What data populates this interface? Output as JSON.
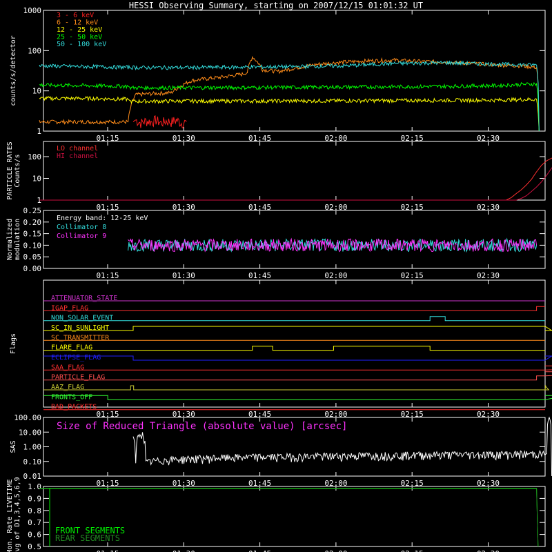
{
  "title": "HESSI Observing Summary, starting on 2007/12/15 01:01:32 UT",
  "time_ticks": [
    "01:15",
    "01:30",
    "01:45",
    "02:00",
    "02:15",
    "02:30"
  ],
  "colors": {
    "e3_6": "#ff2020",
    "e6_12": "#ff8c1a",
    "e12_25": "#ffff00",
    "e25_50": "#00ff00",
    "e50_100": "#33dddd",
    "lo": "#ff3030",
    "hi": "#cc1040",
    "coll8": "#33dddd",
    "coll9": "#ff33ff",
    "white": "#ffffff"
  },
  "chart_data": [
    {
      "type": "line",
      "panel": "count_rates",
      "ylabel": "counts/s/detector",
      "yscale": "log",
      "ylim": [
        1,
        1000
      ],
      "yticks": [
        "1",
        "10",
        "100",
        "1000"
      ],
      "x_unit": "minutes since 01:01:32",
      "xlim": [
        0,
        108
      ],
      "series": [
        {
          "name": "3 - 6 keV",
          "color": "#ff2020",
          "x": [
            18.5,
            19,
            20,
            21,
            22,
            23,
            24,
            25,
            26,
            27,
            28,
            29
          ],
          "y": [
            1.7,
            1.9,
            1.6,
            1.8,
            1.7,
            1.9,
            1.6,
            1.8,
            1.7,
            1.9,
            1.6,
            1.7
          ]
        },
        {
          "name": "6 - 12 keV",
          "color": "#ff8c1a",
          "x": [
            0,
            5,
            10,
            14,
            17.5,
            19,
            22,
            26,
            30,
            33,
            36,
            38,
            40,
            41,
            42,
            44,
            47,
            50,
            55,
            60,
            65,
            70,
            75,
            80,
            85,
            90,
            95,
            98,
            98.5
          ],
          "y": [
            1.7,
            1.7,
            1.7,
            1.7,
            1.7,
            8,
            8.5,
            9,
            18,
            20,
            22,
            24,
            26,
            29,
            70,
            34,
            30,
            36,
            46,
            52,
            56,
            58,
            54,
            52,
            48,
            44,
            42,
            38,
            1
          ]
        },
        {
          "name": "12 - 25 keV",
          "color": "#ffff00",
          "x": [
            0,
            10,
            17.5,
            18,
            30,
            45,
            60,
            75,
            90,
            98,
            98.5
          ],
          "y": [
            6.5,
            6.5,
            6.2,
            5.5,
            5.6,
            5.6,
            5.7,
            5.8,
            5.9,
            6.2,
            1
          ]
        },
        {
          "name": "25 - 50 keV",
          "color": "#00ff00",
          "x": [
            0,
            10,
            17.5,
            18,
            30,
            45,
            60,
            75,
            90,
            98,
            98.5
          ],
          "y": [
            14,
            13.5,
            13,
            12,
            12,
            12.2,
            12.5,
            12.8,
            13.5,
            15,
            1
          ]
        },
        {
          "name": "50 - 100 keV",
          "color": "#33dddd",
          "x": [
            0,
            10,
            20,
            30,
            40,
            50,
            60,
            70,
            80,
            90,
            98,
            98.5
          ],
          "y": [
            42,
            40,
            38,
            38,
            39,
            40,
            42,
            48,
            50,
            46,
            44,
            1
          ]
        }
      ]
    },
    {
      "type": "line",
      "panel": "particle_rates",
      "ylabel": "PARTICLE RATES Counts/s",
      "yscale": "log",
      "ylim": [
        1,
        500
      ],
      "yticks": [
        "1",
        "10",
        "100"
      ],
      "x_unit": "minutes since 01:01:32",
      "xlim": [
        0,
        108
      ],
      "series": [
        {
          "name": "LO channel",
          "color": "#ff3030",
          "x": [
            0,
            92,
            93,
            94,
            95,
            96,
            97,
            98,
            99,
            100,
            101,
            102,
            104,
            106,
            110,
            116,
            118,
            119,
            120,
            121,
            122,
            123,
            124,
            125,
            126,
            130
          ],
          "y": [
            1,
            1,
            1.3,
            2,
            3,
            5,
            9,
            20,
            40,
            65,
            85,
            100,
            115,
            120,
            120,
            118,
            110,
            90,
            60,
            30,
            10,
            3,
            1.5,
            1,
            1,
            1
          ]
        },
        {
          "name": "HI channel",
          "color": "#cc1040",
          "x": [
            0,
            94,
            95,
            96,
            97,
            98,
            99,
            100,
            101,
            102,
            103,
            104,
            106,
            108,
            112,
            118,
            120,
            121,
            122,
            123,
            124,
            125,
            126,
            127,
            130
          ],
          "y": [
            1,
            1,
            1.2,
            1.6,
            2.5,
            4,
            7,
            14,
            30,
            55,
            80,
            95,
            105,
            110,
            110,
            105,
            95,
            70,
            40,
            18,
            6,
            2,
            1.2,
            1,
            1
          ]
        }
      ]
    },
    {
      "type": "line",
      "panel": "modulation",
      "ylabel": "Normalized modulation",
      "ylim": [
        0,
        0.25
      ],
      "yticks": [
        "0.00",
        "0.05",
        "0.10",
        "0.15",
        "0.20",
        "0.25"
      ],
      "annotation": "Energy band: 12-25 keV",
      "x_unit": "minutes since 01:01:32",
      "xlim": [
        0,
        108
      ],
      "series": [
        {
          "name": "Collimator 8",
          "color": "#33dddd",
          "x": [
            17.5,
            30,
            45,
            60,
            75,
            90,
            98
          ],
          "y": [
            0.1,
            0.1,
            0.1,
            0.1,
            0.1,
            0.1,
            0.1
          ]
        },
        {
          "name": "Collimator 9",
          "color": "#ff33ff",
          "x": [
            17.5,
            30,
            45,
            60,
            75,
            90,
            98
          ],
          "y": [
            0.1,
            0.1,
            0.1,
            0.1,
            0.1,
            0.1,
            0.1
          ]
        }
      ]
    },
    {
      "type": "line",
      "panel": "flags",
      "ylabel": "Flags",
      "flags": [
        {
          "name": "ATTENUATOR_STATE",
          "color": "#cc33cc",
          "segments": [
            [
              0,
              130,
              0
            ]
          ]
        },
        {
          "name": "IGAP_FLAG",
          "color": "#ff3030",
          "segments": [
            [
              0,
              98,
              0
            ],
            [
              98,
              130,
              1
            ]
          ]
        },
        {
          "name": "NON_SOLAR_EVENT",
          "color": "#33dddd",
          "segments": [
            [
              0,
              77,
              0
            ],
            [
              77,
              80,
              1
            ],
            [
              80,
              130,
              0
            ]
          ]
        },
        {
          "name": "SC_IN_SUNLIGHT",
          "color": "#ffff00",
          "segments": [
            [
              0,
              18.5,
              0
            ],
            [
              18.5,
              101,
              1
            ],
            [
              101,
              130,
              0
            ]
          ]
        },
        {
          "name": "SC_TRANSMITTER",
          "color": "#ff8c1a",
          "segments": [
            [
              0,
              130,
              0
            ]
          ]
        },
        {
          "name": "FLARE_FLAG",
          "color": "#ffff00",
          "segments": [
            [
              0,
              42,
              0
            ],
            [
              42,
              46,
              1
            ],
            [
              46,
              58,
              0
            ],
            [
              58,
              77,
              1
            ],
            [
              77,
              130,
              0
            ]
          ]
        },
        {
          "name": "ECLIPSE_FLAG",
          "color": "#2020ff",
          "segments": [
            [
              0,
              18.5,
              1
            ],
            [
              18.5,
              101,
              0
            ],
            [
              101,
              130,
              1
            ]
          ]
        },
        {
          "name": "SAA_FLAG",
          "color": "#ff3030",
          "segments": [
            [
              0,
              119,
              0
            ],
            [
              119,
              130,
              1
            ]
          ]
        },
        {
          "name": "PARTICLE_FLAG",
          "color": "#ff5050",
          "segments": [
            [
              0,
              98,
              0
            ],
            [
              98,
              116,
              1
            ],
            [
              116,
              130,
              2
            ]
          ]
        },
        {
          "name": "AAZ_FLAG",
          "color": "#cccc33",
          "segments": [
            [
              0,
              18,
              0
            ],
            [
              18,
              18.6,
              1
            ],
            [
              18.6,
              99.8,
              0
            ],
            [
              99.8,
              100.4,
              1
            ],
            [
              100.4,
              130,
              0
            ]
          ]
        },
        {
          "name": "FRONTS_OFF",
          "color": "#33ff33",
          "segments": [
            [
              0,
              13.5,
              1
            ],
            [
              13.5,
              104,
              0
            ],
            [
              104,
              130,
              1
            ]
          ]
        },
        {
          "name": "BAD_PACKETS",
          "color": "#ff3030",
          "segments": [
            [
              0,
              130,
              0
            ]
          ]
        }
      ]
    },
    {
      "type": "line",
      "panel": "sas",
      "ylabel": "SAS",
      "yscale": "log",
      "ylim": [
        0.01,
        100
      ],
      "yticks": [
        "0.01",
        "0.10",
        "1.00",
        "10.00",
        "100.00"
      ],
      "annotation": "Size of Reduced Triangle (absolute value) [arcsec]",
      "x_unit": "minutes since 01:01:32",
      "xlim": [
        0,
        108
      ],
      "series": [
        {
          "name": "",
          "color": "#ffffff",
          "x": [
            18.5,
            19,
            20,
            21,
            22,
            24,
            26,
            30,
            40,
            50,
            60,
            70,
            80,
            90,
            95,
            100,
            100.5,
            101
          ],
          "y": [
            5,
            0.06,
            10,
            0.08,
            0.1,
            0.12,
            0.14,
            0.16,
            0.2,
            0.22,
            0.25,
            0.28,
            0.3,
            0.32,
            0.33,
            0.34,
            100,
            0.01
          ]
        }
      ]
    },
    {
      "type": "line",
      "panel": "livetime",
      "ylabel": "Mon. Rate LIVETIME avg of D1,3,4,5,6,9",
      "ylim": [
        0.5,
        1.0
      ],
      "yticks": [
        "0.5",
        "0.6",
        "0.7",
        "0.8",
        "0.9",
        "1.0"
      ],
      "x_unit": "minutes since 01:01:32",
      "xlim": [
        0,
        108
      ],
      "series": [
        {
          "name": "FRONT SEGMENTS",
          "color": "#00ee00",
          "x": [
            0,
            98,
            98.3
          ],
          "y": [
            0.985,
            0.985,
            0.5
          ]
        },
        {
          "name": "REAR SEGMENTS",
          "color": "#228b22",
          "x": [
            0,
            98,
            98.3
          ],
          "y": [
            0.982,
            0.982,
            0.5
          ]
        }
      ]
    }
  ]
}
